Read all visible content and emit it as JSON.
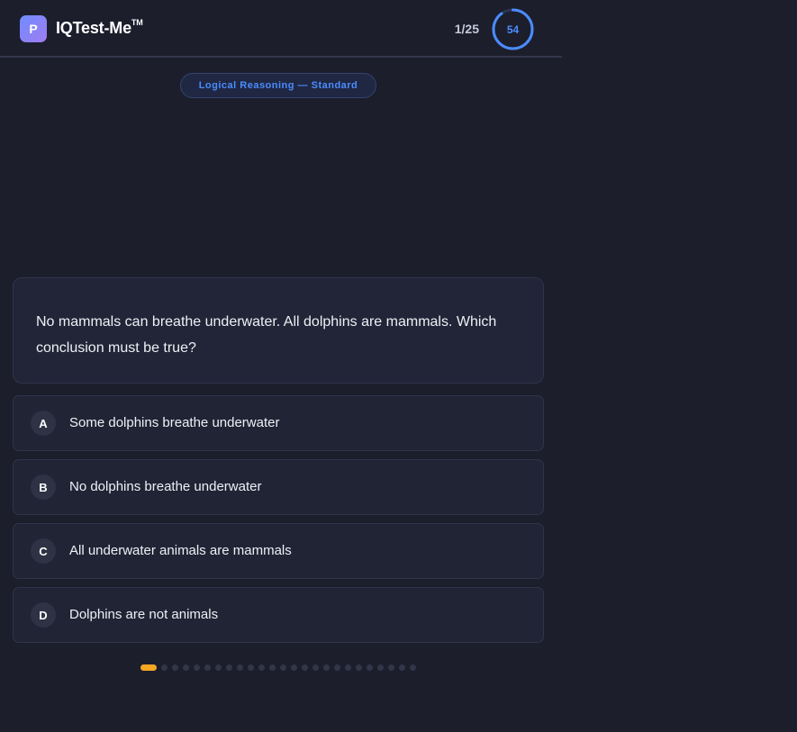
{
  "header": {
    "logo_letter": "P",
    "brand_name": "IQTest-Me",
    "brand_mark": "TM",
    "progress": "1/25",
    "current_question": 1,
    "total_questions": 25,
    "timer_value": "54",
    "timer_fraction_remaining": 0.9
  },
  "category": {
    "label": "Logical Reasoning — Standard"
  },
  "question": {
    "text": "No mammals can breathe underwater. All dolphins are mammals. Which conclusion must be true?"
  },
  "options": [
    {
      "letter": "A",
      "text": "Some dolphins breathe underwater"
    },
    {
      "letter": "B",
      "text": "No dolphins breathe underwater"
    },
    {
      "letter": "C",
      "text": "All underwater animals are mammals"
    },
    {
      "letter": "D",
      "text": "Dolphins are not animals"
    }
  ],
  "pager": {
    "total": 25,
    "current": 1
  },
  "colors": {
    "background": "#1c1e2c",
    "accent_blue": "#4b8cff",
    "active_dot": "#f5a623",
    "logo_gradient_start": "#6f8cff",
    "logo_gradient_end": "#a07cf2"
  }
}
